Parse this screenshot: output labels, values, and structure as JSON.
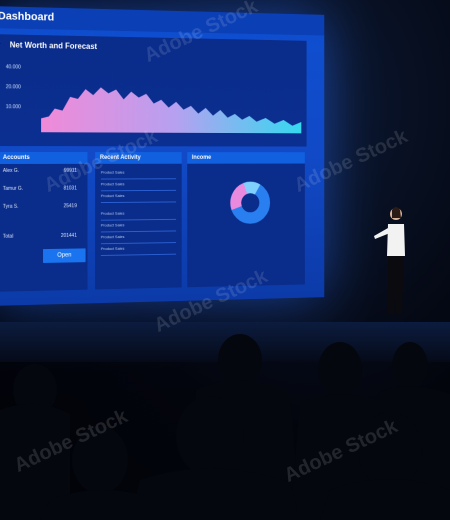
{
  "screen": {
    "title": "Dashboard",
    "net_worth": {
      "title": "Net Worth and Forecast",
      "y_labels": [
        "40.000",
        "20.000",
        "10.000"
      ]
    },
    "accounts": {
      "title": "Accounts",
      "rows": [
        {
          "name": "Alex G.",
          "value": "99911"
        },
        {
          "name": "Tamur G.",
          "value": "81031"
        },
        {
          "name": "Tyra S.",
          "value": "25419"
        },
        {
          "name": "Total",
          "value": "201441"
        }
      ],
      "open_label": "Open"
    },
    "activity": {
      "title": "Recent Activity",
      "rows": [
        "Product Sales",
        "Product Sales",
        "Product Sales",
        "Product Sales",
        "Product Sales",
        "Product Sales",
        "Product Sales"
      ]
    },
    "income": {
      "title": "Income"
    }
  },
  "watermark": "Adobe Stock",
  "colors": {
    "screen_blue": "#0e4fd0",
    "chart_pink": "#e98adf",
    "chart_cyan": "#3fd6f0",
    "donut_blue": "#2a7ff0"
  }
}
